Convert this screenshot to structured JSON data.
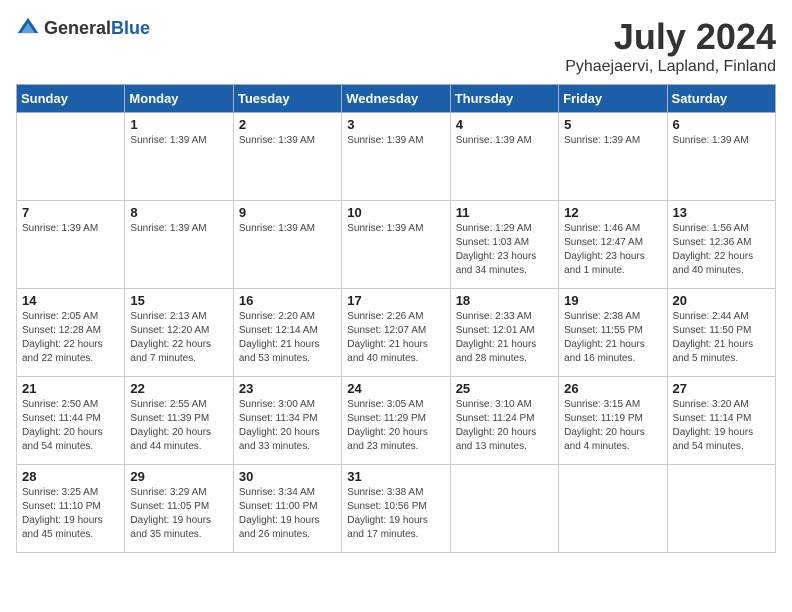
{
  "logo": {
    "general": "General",
    "blue": "Blue"
  },
  "title": "July 2024",
  "subtitle": "Pyhaejaervi, Lapland, Finland",
  "headers": [
    "Sunday",
    "Monday",
    "Tuesday",
    "Wednesday",
    "Thursday",
    "Friday",
    "Saturday"
  ],
  "weeks": [
    [
      {
        "day": "",
        "info": ""
      },
      {
        "day": "1",
        "info": "Sunrise: 1:39 AM"
      },
      {
        "day": "2",
        "info": "Sunrise: 1:39 AM"
      },
      {
        "day": "3",
        "info": "Sunrise: 1:39 AM"
      },
      {
        "day": "4",
        "info": "Sunrise: 1:39 AM"
      },
      {
        "day": "5",
        "info": "Sunrise: 1:39 AM"
      },
      {
        "day": "6",
        "info": "Sunrise: 1:39 AM"
      }
    ],
    [
      {
        "day": "7",
        "info": "Sunrise: 1:39 AM"
      },
      {
        "day": "8",
        "info": "Sunrise: 1:39 AM"
      },
      {
        "day": "9",
        "info": "Sunrise: 1:39 AM"
      },
      {
        "day": "10",
        "info": "Sunrise: 1:39 AM"
      },
      {
        "day": "11",
        "info": "Sunrise: 1:29 AM\nSunset: 1:03 AM\nDaylight: 23 hours and 34 minutes."
      },
      {
        "day": "12",
        "info": "Sunrise: 1:46 AM\nSunset: 12:47 AM\nDaylight: 23 hours and 1 minute."
      },
      {
        "day": "13",
        "info": "Sunrise: 1:56 AM\nSunset: 12:36 AM\nDaylight: 22 hours and 40 minutes."
      }
    ],
    [
      {
        "day": "14",
        "info": "Sunrise: 2:05 AM\nSunset: 12:28 AM\nDaylight: 22 hours and 22 minutes."
      },
      {
        "day": "15",
        "info": "Sunrise: 2:13 AM\nSunset: 12:20 AM\nDaylight: 22 hours and 7 minutes."
      },
      {
        "day": "16",
        "info": "Sunrise: 2:20 AM\nSunset: 12:14 AM\nDaylight: 21 hours and 53 minutes."
      },
      {
        "day": "17",
        "info": "Sunrise: 2:26 AM\nSunset: 12:07 AM\nDaylight: 21 hours and 40 minutes."
      },
      {
        "day": "18",
        "info": "Sunrise: 2:33 AM\nSunset: 12:01 AM\nDaylight: 21 hours and 28 minutes."
      },
      {
        "day": "19",
        "info": "Sunrise: 2:38 AM\nSunset: 11:55 PM\nDaylight: 21 hours and 16 minutes."
      },
      {
        "day": "20",
        "info": "Sunrise: 2:44 AM\nSunset: 11:50 PM\nDaylight: 21 hours and 5 minutes."
      }
    ],
    [
      {
        "day": "21",
        "info": "Sunrise: 2:50 AM\nSunset: 11:44 PM\nDaylight: 20 hours and 54 minutes."
      },
      {
        "day": "22",
        "info": "Sunrise: 2:55 AM\nSunset: 11:39 PM\nDaylight: 20 hours and 44 minutes."
      },
      {
        "day": "23",
        "info": "Sunrise: 3:00 AM\nSunset: 11:34 PM\nDaylight: 20 hours and 33 minutes."
      },
      {
        "day": "24",
        "info": "Sunrise: 3:05 AM\nSunset: 11:29 PM\nDaylight: 20 hours and 23 minutes."
      },
      {
        "day": "25",
        "info": "Sunrise: 3:10 AM\nSunset: 11:24 PM\nDaylight: 20 hours and 13 minutes."
      },
      {
        "day": "26",
        "info": "Sunrise: 3:15 AM\nSunset: 11:19 PM\nDaylight: 20 hours and 4 minutes."
      },
      {
        "day": "27",
        "info": "Sunrise: 3:20 AM\nSunset: 11:14 PM\nDaylight: 19 hours and 54 minutes."
      }
    ],
    [
      {
        "day": "28",
        "info": "Sunrise: 3:25 AM\nSunset: 11:10 PM\nDaylight: 19 hours and 45 minutes."
      },
      {
        "day": "29",
        "info": "Sunrise: 3:29 AM\nSunset: 11:05 PM\nDaylight: 19 hours and 35 minutes."
      },
      {
        "day": "30",
        "info": "Sunrise: 3:34 AM\nSunset: 11:00 PM\nDaylight: 19 hours and 26 minutes."
      },
      {
        "day": "31",
        "info": "Sunrise: 3:38 AM\nSunset: 10:56 PM\nDaylight: 19 hours and 17 minutes."
      },
      {
        "day": "",
        "info": ""
      },
      {
        "day": "",
        "info": ""
      },
      {
        "day": "",
        "info": ""
      }
    ]
  ]
}
